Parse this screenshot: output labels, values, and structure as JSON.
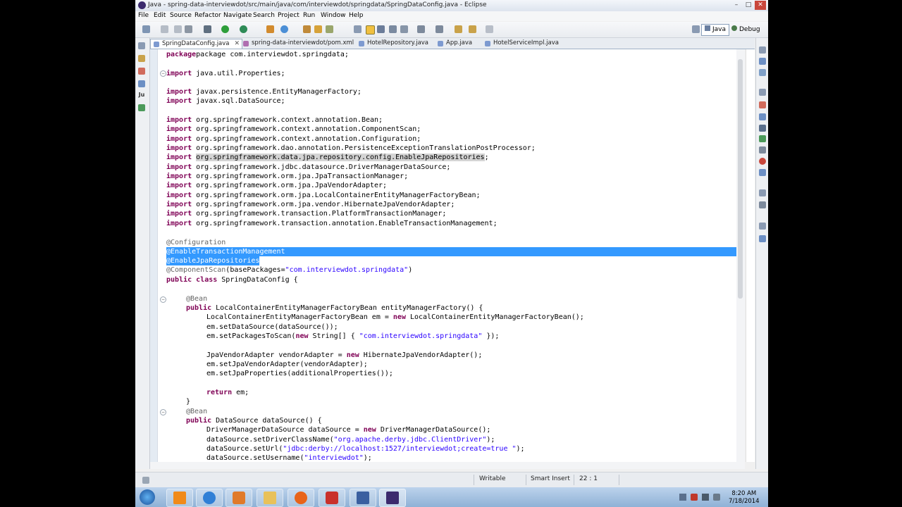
{
  "window": {
    "title": "Java - spring-data-interviewdot/src/main/java/com/interviewdot/springdata/SpringDataConfig.java - Eclipse",
    "minimize": "–",
    "maximize": "□",
    "close": "✕"
  },
  "menu": [
    "File",
    "Edit",
    "Source",
    "Refactor",
    "Navigate",
    "Search",
    "Project",
    "Run",
    "Window",
    "Help"
  ],
  "perspectives": {
    "java": "Java",
    "debug": "Debug"
  },
  "tabs": [
    {
      "label": "SpringDataConfig.java",
      "close": "✕"
    },
    {
      "label": "spring-data-interviewdot/pom.xml"
    },
    {
      "label": "HotelRepository.java"
    },
    {
      "label": "App.java"
    },
    {
      "label": "HotelServiceImpl.java"
    }
  ],
  "code": {
    "l1": "package com.interviewdot.springdata;",
    "import_kw": "import",
    "l3": " java.util.Properties;",
    "l5": " javax.persistence.EntityManagerFactory;",
    "l6": " javax.sql.DataSource;",
    "l8": " org.springframework.context.annotation.Bean;",
    "l9": " org.springframework.context.annotation.ComponentScan;",
    "l10": " org.springframework.context.annotation.Configuration;",
    "l11": " org.springframework.dao.annotation.PersistenceExceptionTranslationPostProcessor;",
    "l12": "org.springframework.data.jpa.repository.config.EnableJpaRepositories",
    "l12b": ";",
    "l13": " org.springframework.jdbc.datasource.DriverManagerDataSource;",
    "l14": " org.springframework.orm.jpa.JpaTransactionManager;",
    "l15": " org.springframework.orm.jpa.JpaVendorAdapter;",
    "l16": " org.springframework.orm.jpa.LocalContainerEntityManagerFactoryBean;",
    "l17": " org.springframework.orm.jpa.vendor.HibernateJpaVendorAdapter;",
    "l18": " org.springframework.transaction.PlatformTransactionManager;",
    "l19": " org.springframework.transaction.annotation.EnableTransactionManagement;",
    "l21": "@Configuration",
    "l22": "@EnableTransactionManagement",
    "l23": "@EnableJpaRepositories",
    "l24a": "@ComponentScan",
    "l24b": "(basePackages=",
    "l24c": "\"com.interviewdot.springdata\"",
    "l24d": ")",
    "public_kw": "public",
    "class_kw": "class",
    "l25b": " SpringDataConfig {",
    "bean": "@Bean",
    "l28b": " LocalContainerEntityManagerFactoryBean entityManagerFactory() {",
    "l29a": "LocalContainerEntityManagerFactoryBean em = ",
    "new_kw": "new",
    "l29c": " LocalContainerEntityManagerFactoryBean();",
    "l30": "em.setDataSource(dataSource());",
    "l31a": "em.setPackagesToScan(",
    "l31c": " String[] { ",
    "l31d": "\"com.interviewdot.springdata\"",
    "l31e": " });",
    "l33a": "JpaVendorAdapter vendorAdapter = ",
    "l33c": " HibernateJpaVendorAdapter();",
    "l34": "em.setJpaVendorAdapter(vendorAdapter);",
    "l35": "em.setJpaProperties(additionalProperties());",
    "return_kw": "return",
    "l37b": " em;",
    "l38": "}",
    "l40b": " DataSource dataSource() {",
    "l41a": "DriverManagerDataSource dataSource = ",
    "l41c": " DriverManagerDataSource();",
    "l42a": "dataSource.setDriverClassName(",
    "l42b": "\"org.apache.derby.jdbc.ClientDriver\"",
    "l42c": ");",
    "l43a": "dataSource.setUrl(",
    "l43b": "\"jdbc:derby://localhost:1527/interviewdot;create=true \"",
    "l43c": ");",
    "l44a": "dataSource.setUsername(",
    "l44b": "\"interviewdot\"",
    "l44c": ");"
  },
  "status": {
    "writable": "Writable",
    "insert": "Smart Insert",
    "position": "22 : 1"
  },
  "taskbar": {
    "time": "8:20 AM",
    "date": "7/18/2014"
  },
  "colors": {
    "keyword": "#7f0055",
    "annotation": "#646464",
    "string": "#2a00ff",
    "selection": "#3399ff"
  }
}
